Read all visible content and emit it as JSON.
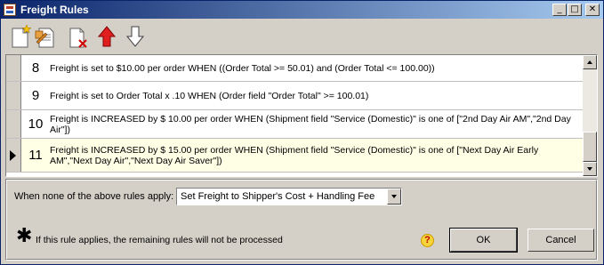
{
  "window": {
    "title": "Freight Rules"
  },
  "title_buttons": {
    "minimize": "_",
    "maximize": "□",
    "close": "✕"
  },
  "toolbar": {
    "tools": [
      {
        "name": "new-rule",
        "icon": "new-document-star-icon"
      },
      {
        "name": "edit-rule",
        "icon": "edit-document-icon"
      },
      {
        "name": "delete-rule",
        "icon": "delete-document-icon"
      },
      {
        "name": "move-up",
        "icon": "red-up-arrow-icon"
      },
      {
        "name": "move-down",
        "icon": "outline-down-arrow-icon"
      }
    ]
  },
  "rules": [
    {
      "num": "8",
      "text": "Freight is set to $10.00 per order WHEN ((Order Total >= 50.01)  and  (Order Total <= 100.00))"
    },
    {
      "num": "9",
      "text": "Freight is set to Order Total x .10 WHEN (Order field \"Order Total\" >= 100.01)"
    },
    {
      "num": "10",
      "text": "Freight is INCREASED by $ 10.00 per order WHEN (Shipment field \"Service (Domestic)\" is one of [\"2nd Day Air AM\",\"2nd Day Air\"])"
    },
    {
      "num": "11",
      "text": "Freight is INCREASED by $ 15.00 per order WHEN (Shipment field \"Service (Domestic)\" is one of [\"Next Day Air Early AM\",\"Next Day Air\",\"Next Day Air Saver\"])"
    }
  ],
  "selected_rule_index": 3,
  "none_apply": {
    "label": "When none of the above rules apply:",
    "selected": "Set Freight to Shipper's Cost + Handling Fee"
  },
  "legend": {
    "symbol": "✱",
    "text": "If this rule applies, the remaining rules will not be processed"
  },
  "help_icon": "?",
  "buttons": {
    "ok": "OK",
    "cancel": "Cancel"
  },
  "colors": {
    "titlebar_start": "#0a246a",
    "titlebar_end": "#a6caf0",
    "selected_row": "#ffffe6",
    "face": "#d4d0c8"
  }
}
